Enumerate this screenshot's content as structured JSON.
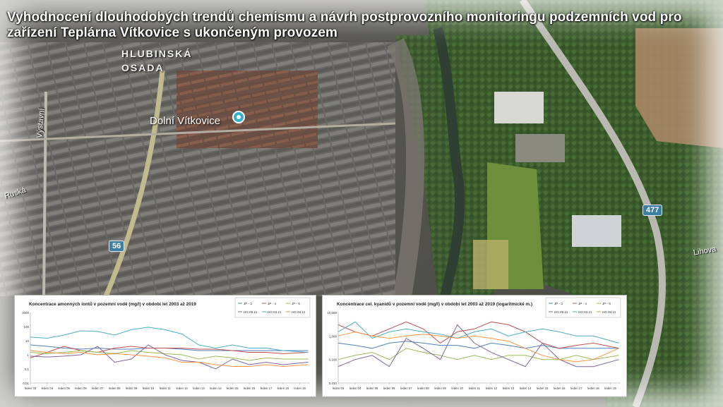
{
  "slide": {
    "title": "Vyhodnocení dlouhodobých trendů chemismu a návrh postprovozního monitoringu podzemních vod pro zařízení Teplárna Vítkovice s ukončeným provozem"
  },
  "map": {
    "district_label": "HLUBINSKÁ OSADA",
    "district_line1": "HLUBINSKÁ",
    "district_line2": "OSADA",
    "poi_label": "Dolní Vítkovice",
    "streets": [
      "Výstavní",
      "Ruská",
      "Lihova"
    ],
    "road_shields": [
      "56",
      "477"
    ],
    "colors": {
      "shield": "#3f7ea3",
      "poi": "#34b0c8"
    }
  },
  "chart_data": [
    {
      "type": "line",
      "title": "Koncentrace amonných iontů v pozemní vodě (mg/l) v období let 2003 až 2019",
      "yscale": "log",
      "ylim": [
        0.01,
        1000
      ],
      "yticks": [
        "0,01",
        "0,1",
        "1",
        "10",
        "100",
        "1000"
      ],
      "ytick_values": [
        0.01,
        0.1,
        1,
        10,
        100,
        1000
      ],
      "xlim": [
        2003,
        2019.6
      ],
      "xticks": [
        "leden 03",
        "leden 04",
        "leden 05",
        "leden 06",
        "leden 07",
        "leden 08",
        "leden 09",
        "leden 10",
        "leden 11",
        "leden 12",
        "leden 13",
        "leden 14",
        "leden 15",
        "leden 16",
        "leden 17",
        "leden 18",
        "leden 19"
      ],
      "grid": false,
      "legend": "top-right",
      "series": [
        {
          "name": "JP - 3",
          "color": "#4f81bd",
          "x": [
            2003,
            2004,
            2005,
            2006,
            2007,
            2008,
            2009,
            2010,
            2011,
            2012,
            2013,
            2014,
            2015,
            2016,
            2017,
            2018,
            2019.5
          ],
          "y": [
            5,
            4,
            3,
            2.5,
            3,
            2.5,
            2.5,
            3,
            3,
            2.5,
            2,
            2,
            2,
            2,
            2,
            2,
            2
          ]
        },
        {
          "name": "JP - 4",
          "color": "#c0504d",
          "x": [
            2003,
            2004,
            2005,
            2006,
            2007,
            2008,
            2009,
            2010,
            2011,
            2012,
            2013,
            2014,
            2015,
            2016,
            2017,
            2018,
            2019.5
          ],
          "y": [
            0.6,
            1.5,
            4,
            2,
            1.5,
            3,
            4,
            3,
            3,
            3,
            2.5,
            2.5,
            2,
            1.5,
            1.5,
            1.2,
            1.5
          ]
        },
        {
          "name": "JP - 6",
          "color": "#9bbb59",
          "x": [
            2003,
            2004,
            2005,
            2006,
            2007,
            2008,
            2009,
            2010,
            2011,
            2012,
            2013,
            2014,
            2015,
            2016,
            2017,
            2018,
            2019.5
          ],
          "y": [
            1.5,
            1.2,
            1.5,
            2,
            1.5,
            1.2,
            2,
            1.5,
            1.2,
            1,
            0.5,
            0.8,
            0.6,
            0.4,
            0.6,
            0.5,
            0.5
          ]
        },
        {
          "name": "HG 02.11",
          "color": "#8064a2",
          "x": [
            2003,
            2004,
            2005,
            2006,
            2007,
            2008,
            2009,
            2010,
            2011,
            2012,
            2013,
            2014,
            2015,
            2016,
            2017,
            2018,
            2019.5
          ],
          "y": [
            0.8,
            0.7,
            0.8,
            1,
            4,
            0.3,
            0.5,
            5,
            1,
            0.4,
            0.3,
            0.1,
            0.5,
            0.2,
            0.3,
            0.2,
            0.3
          ]
        },
        {
          "name": "HG 03.11",
          "color": "#4bacc6",
          "x": [
            2003,
            2004,
            2005,
            2006,
            2007,
            2008,
            2009,
            2010,
            2011,
            2012,
            2013,
            2014,
            2015,
            2016,
            2017,
            2018,
            2019.5
          ],
          "y": [
            18,
            15,
            25,
            50,
            45,
            25,
            60,
            90,
            60,
            30,
            5,
            3,
            5,
            3,
            3,
            2,
            1.5
          ]
        },
        {
          "name": "HG 04.11",
          "color": "#f79646",
          "x": [
            2003,
            2004,
            2005,
            2006,
            2007,
            2008,
            2009,
            2010,
            2011,
            2012,
            2013,
            2014,
            2015,
            2016,
            2017,
            2018,
            2019.5
          ],
          "y": [
            2,
            1.5,
            1.2,
            1.5,
            1,
            1.2,
            1,
            0.8,
            0.6,
            0.3,
            0.3,
            0.2,
            0.15,
            0.15,
            0.2,
            0.15,
            0.2
          ]
        }
      ]
    },
    {
      "type": "line",
      "title": "Koncentrace cel. kyanidů v pozemní vodě (mg/l) v období let 2003 až 2019 (logaritmické m.)",
      "yscale": "log",
      "ylim": [
        0.01,
        10
      ],
      "yticks": [
        "0,010",
        "0,100",
        "1,000",
        "10,000"
      ],
      "ytick_values": [
        0.01,
        0.1,
        1,
        10
      ],
      "xlim": [
        2003,
        2019.6
      ],
      "xticks": [
        "leden 03",
        "leden 04",
        "leden 05",
        "leden 06",
        "leden 07",
        "leden 08",
        "leden 09",
        "leden 10",
        "leden 11",
        "leden 12",
        "leden 13",
        "leden 14",
        "leden 15",
        "leden 16",
        "leden 17",
        "leden 18",
        "leden 19"
      ],
      "grid": false,
      "legend": "top-right",
      "series": [
        {
          "name": "JP - 3",
          "color": "#4f81bd",
          "x": [
            2003,
            2004,
            2005,
            2006,
            2007,
            2008,
            2009,
            2010,
            2011,
            2012,
            2013,
            2014,
            2015,
            2016,
            2017,
            2018,
            2019.5
          ],
          "y": [
            0.5,
            0.4,
            0.3,
            0.5,
            0.6,
            0.5,
            0.4,
            0.4,
            0.3,
            0.5,
            0.4,
            0.3,
            0.4,
            0.3,
            0.3,
            0.3,
            0.3
          ]
        },
        {
          "name": "JP - 4",
          "color": "#c0504d",
          "x": [
            2003,
            2004,
            2005,
            2006,
            2007,
            2008,
            2009,
            2010,
            2011,
            2012,
            2013,
            2014,
            2015,
            2016,
            2017,
            2018,
            2019.5
          ],
          "y": [
            3,
            1.5,
            1,
            2,
            4,
            2,
            0.5,
            1.5,
            2,
            4,
            3,
            1.5,
            0.5,
            0.3,
            0.4,
            0.5,
            0.3
          ]
        },
        {
          "name": "JP - 6",
          "color": "#9bbb59",
          "x": [
            2003,
            2004,
            2005,
            2006,
            2007,
            2008,
            2009,
            2010,
            2011,
            2012,
            2013,
            2014,
            2015,
            2016,
            2017,
            2018,
            2019.5
          ],
          "y": [
            0.1,
            0.15,
            0.2,
            0.1,
            0.3,
            0.2,
            0.15,
            0.1,
            0.15,
            0.1,
            0.15,
            0.15,
            0.1,
            0.1,
            0.15,
            0.1,
            0.15
          ]
        },
        {
          "name": "HG 02.11",
          "color": "#8064a2",
          "x": [
            2003,
            2004,
            2005,
            2006,
            2007,
            2008,
            2009,
            2010,
            2011,
            2012,
            2013,
            2014,
            2015,
            2016,
            2017,
            2018,
            2019.5
          ],
          "y": [
            0.05,
            0.1,
            0.15,
            0.05,
            0.8,
            0.3,
            0.1,
            3,
            0.5,
            0.2,
            0.1,
            0.05,
            0.5,
            0.1,
            0.05,
            0.05,
            0.1
          ]
        },
        {
          "name": "HG 03.11",
          "color": "#4bacc6",
          "x": [
            2003,
            2004,
            2005,
            2006,
            2007,
            2008,
            2009,
            2010,
            2011,
            2012,
            2013,
            2014,
            2015,
            2016,
            2017,
            2018,
            2019.5
          ],
          "y": [
            1.5,
            4,
            0.8,
            1.5,
            2,
            1.5,
            1.2,
            0.8,
            1.5,
            2,
            1,
            1.5,
            2,
            1.5,
            1,
            1,
            0.5
          ]
        },
        {
          "name": "HG 04.11",
          "color": "#f79646",
          "x": [
            2003,
            2004,
            2005,
            2006,
            2007,
            2008,
            2009,
            2010,
            2011,
            2012,
            2013,
            2014,
            2015,
            2016,
            2017,
            2018,
            2019.5
          ],
          "y": [
            1,
            1.5,
            1,
            0.8,
            1,
            1.2,
            1,
            0.8,
            1,
            0.8,
            0.6,
            0.3,
            0.15,
            0.1,
            0.08,
            0.1,
            0.3
          ]
        }
      ]
    }
  ]
}
